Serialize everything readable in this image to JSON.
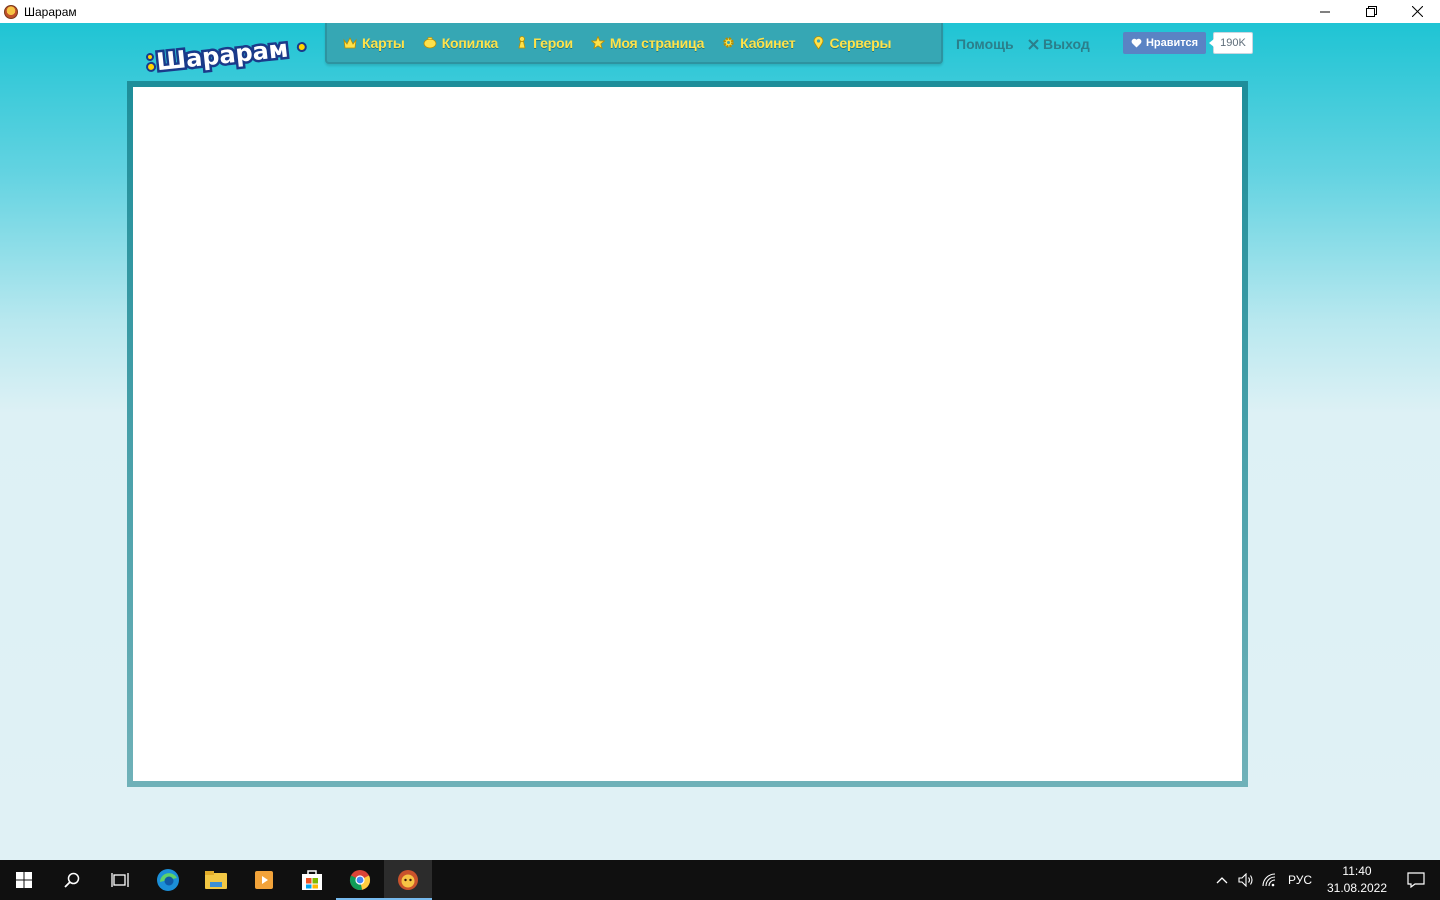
{
  "window": {
    "title": "Шарарам",
    "controls": [
      "minimize",
      "restore",
      "close"
    ]
  },
  "logo": {
    "text": "Шарарам"
  },
  "nav": {
    "items": [
      {
        "label": "Карты",
        "icon": "crown-icon"
      },
      {
        "label": "Копилка",
        "icon": "piggy-bank-icon"
      },
      {
        "label": "Герои",
        "icon": "chess-pawn-icon"
      },
      {
        "label": "Моя страница",
        "icon": "star-icon"
      },
      {
        "label": "Кабинет",
        "icon": "gear-icon"
      },
      {
        "label": "Серверы",
        "icon": "location-pin-icon"
      }
    ],
    "help": "Помощь",
    "logout": "Выход"
  },
  "like": {
    "label": "Нравится",
    "count": "190K"
  },
  "taskbar": {
    "apps": [
      "start",
      "search",
      "task-view",
      "edge",
      "file-explorer",
      "media-player",
      "store",
      "chrome",
      "shararam"
    ],
    "tray": {
      "language": "РУС",
      "time": "11:40",
      "date": "31.08.2022"
    }
  },
  "colors": {
    "page_top": "#1fc4d4",
    "nav_bg": "#36a7b4",
    "nav_text": "#ffe24a",
    "aux_text": "#2b7f8b",
    "frame_border": "#2a98a4",
    "like_bg": "#5a83c4"
  }
}
